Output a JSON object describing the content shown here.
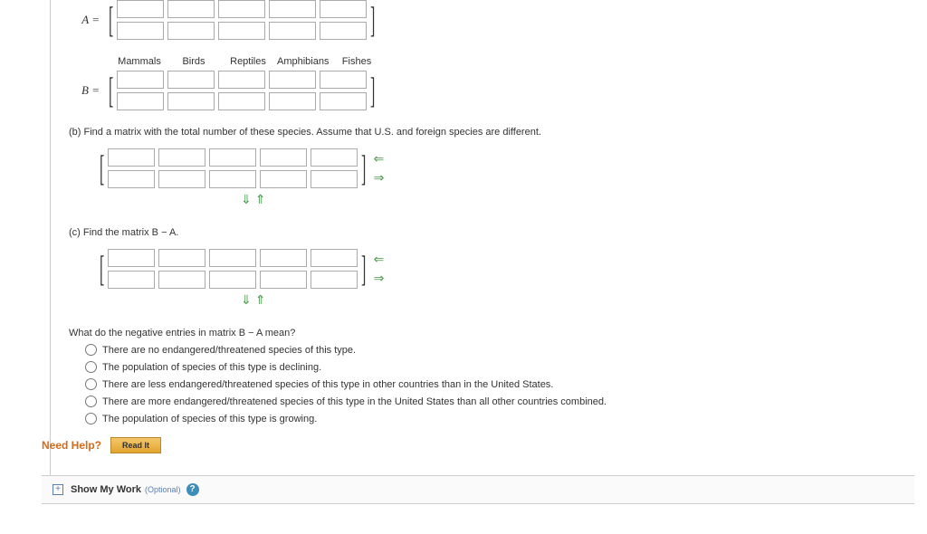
{
  "matrixA": {
    "label": "A ="
  },
  "matrixB": {
    "label": "B =",
    "headers": [
      "Mammals",
      "Birds",
      "Reptiles",
      "Amphibians",
      "Fishes"
    ]
  },
  "partB": {
    "prompt": "(b) Find a matrix with the total number of these species. Assume that U.S. and foreign species are different."
  },
  "partC": {
    "prompt": "(c) Find the matrix B − A."
  },
  "question": {
    "prompt": "What do the negative entries in matrix B − A mean?",
    "options": [
      "There are no endangered/threatened species of this type.",
      "The population of species of this type is declining.",
      "There are less endangered/threatened species of this type in other countries than in the United States.",
      "There are more endangered/threatened species of this type in the United States than all other countries combined.",
      "The population of species of this type is growing."
    ]
  },
  "needHelp": {
    "label": "Need Help?",
    "readIt": "Read It"
  },
  "showWork": {
    "label": "Show My Work",
    "optional": "(Optional)"
  }
}
